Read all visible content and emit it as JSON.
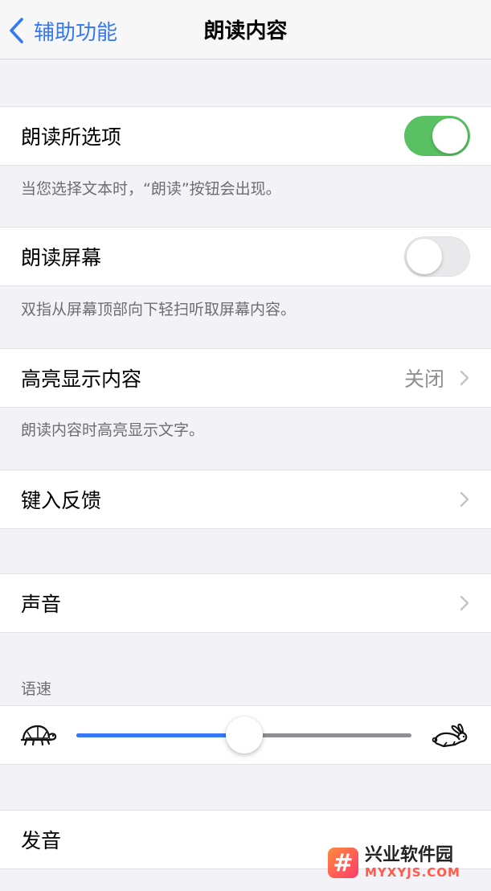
{
  "nav": {
    "back_label": "辅助功能",
    "title": "朗读内容"
  },
  "speak_selection": {
    "label": "朗读所选项",
    "enabled": true,
    "footer": "当您选择文本时，“朗读”按钮会出现。"
  },
  "speak_screen": {
    "label": "朗读屏幕",
    "enabled": false,
    "footer": "双指从屏幕顶部向下轻扫听取屏幕内容。"
  },
  "highlight_content": {
    "label": "高亮显示内容",
    "value": "关闭",
    "footer": "朗读内容时高亮显示文字。"
  },
  "typing_feedback": {
    "label": "键入反馈"
  },
  "voices": {
    "label": "声音"
  },
  "speaking_rate": {
    "header": "语速",
    "value_fraction": 0.5,
    "slow_icon": "turtle-icon",
    "fast_icon": "rabbit-icon"
  },
  "pronunciations": {
    "label": "发音"
  },
  "watermark": {
    "cn": "兴业软件园",
    "en": "MYXYJS.COM"
  },
  "colors": {
    "accent": "#3478f6",
    "toggle_on": "#5ac162",
    "background": "#f2f2f7"
  }
}
